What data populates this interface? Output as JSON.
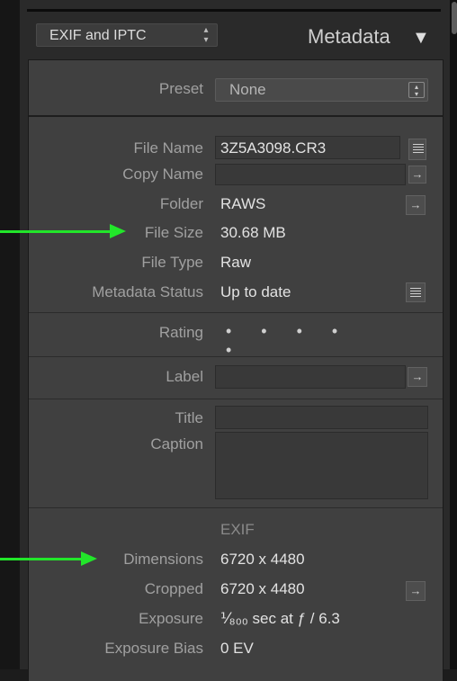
{
  "header": {
    "preset_dropdown": "EXIF and IPTC",
    "title": "Metadata",
    "collapse_glyph": "▼"
  },
  "preset_row": {
    "label": "Preset",
    "value": "None"
  },
  "fields": {
    "file_name": {
      "label": "File Name",
      "value": "3Z5A3098.CR3"
    },
    "copy_name": {
      "label": "Copy Name",
      "value": ""
    },
    "folder": {
      "label": "Folder",
      "value": "RAWS"
    },
    "file_size": {
      "label": "File Size",
      "value": "30.68 MB"
    },
    "file_type": {
      "label": "File Type",
      "value": "Raw"
    },
    "metadata_status": {
      "label": "Metadata Status",
      "value": "Up to date"
    },
    "rating": {
      "label": "Rating",
      "value": "• • • • •"
    },
    "label": {
      "label": "Label",
      "value": ""
    },
    "title": {
      "label": "Title",
      "value": ""
    },
    "caption": {
      "label": "Caption",
      "value": ""
    }
  },
  "exif": {
    "heading": "EXIF",
    "dimensions": {
      "label": "Dimensions",
      "value": "6720 x 4480"
    },
    "cropped": {
      "label": "Cropped",
      "value": "6720 x 4480"
    },
    "exposure": {
      "label": "Exposure",
      "value": "⅟₈₀₀ sec at ƒ / 6.3"
    },
    "exposure_bias": {
      "label": "Exposure Bias",
      "value": "0 EV"
    }
  },
  "icons": {
    "list": "list-icon",
    "go_to": "arrow-right-icon",
    "stepper": "stepper-icon",
    "annotation": "green-arrow-icon"
  },
  "colors": {
    "annotation_arrow": "#22e62a",
    "panel_bg": "#404040"
  }
}
